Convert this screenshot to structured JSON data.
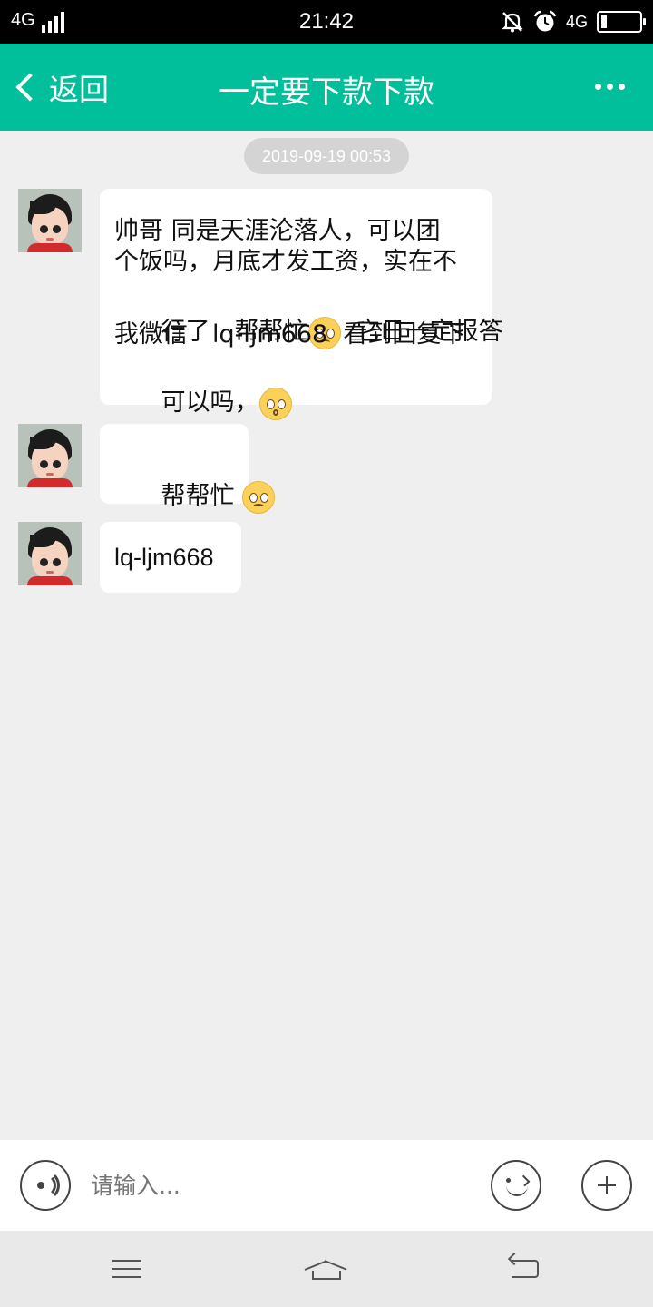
{
  "status_bar": {
    "network_left": "4G",
    "time": "21:42",
    "network_right": "4G",
    "icons": [
      "signal-bars-icon",
      "mute-icon",
      "alarm-icon",
      "battery-icon"
    ]
  },
  "nav": {
    "back_label": "返回",
    "title": "一定要下款下款",
    "more_icon": "more-icon"
  },
  "chat": {
    "timestamp": "2019-09-19 00:53",
    "messages": [
      {
        "lines": [
          "帅哥 同是天涯沦落人，可以团",
          "个饭吗，月底才发工资，实在不",
          "行了　帮帮忙",
          "我微信　lq-ljm668  看到回复下",
          "可以吗，"
        ],
        "line3_tail": "  它日一定报答",
        "emoji_1": "pleading-face-emoji",
        "emoji_2": "hushed-face-emoji"
      },
      {
        "text": "帮帮忙 ",
        "emoji": "pleading-face-emoji"
      },
      {
        "text": "lq-ljm668"
      }
    ]
  },
  "input": {
    "placeholder": "请输入...",
    "voice_icon": "voice-icon",
    "emoji_icon": "emoji-icon",
    "plus_icon": "plus-icon"
  },
  "system_nav": {
    "icons": [
      "menu-icon",
      "home-icon",
      "back-arrow-icon"
    ]
  },
  "colors": {
    "accent": "#00bf9a",
    "background": "#efefef",
    "bubble": "#ffffff"
  }
}
